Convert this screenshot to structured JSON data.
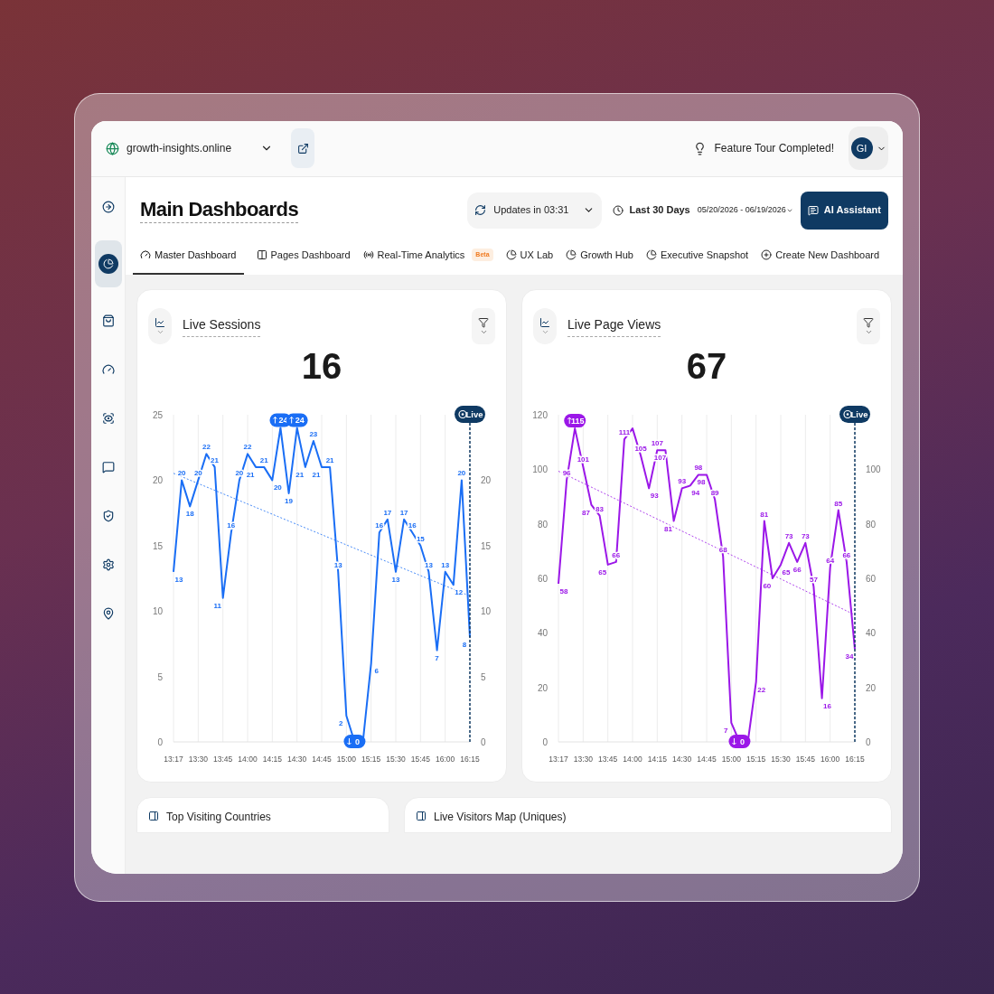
{
  "topbar": {
    "site": "growth-insights.online",
    "tour": "Feature Tour Completed!",
    "avatar": "GI"
  },
  "sidebar": {
    "items": [
      {
        "kind": "collapse",
        "selected": false
      },
      {
        "kind": "dashboard",
        "selected": true
      },
      {
        "kind": "bag",
        "selected": false
      },
      {
        "kind": "gauge",
        "selected": false
      },
      {
        "kind": "scan",
        "selected": false
      },
      {
        "kind": "chat",
        "selected": false
      },
      {
        "kind": "shield",
        "selected": false
      },
      {
        "kind": "settings",
        "selected": false
      },
      {
        "kind": "pin",
        "selected": false
      }
    ]
  },
  "header": {
    "title": "Main Dashboards",
    "updates": "Updates in 03:31",
    "range": "Last 30 Days",
    "dates": "05/20/2026 - 06/19/2026",
    "assistant": "AI Assistant"
  },
  "tabs": [
    {
      "label": "Master Dashboard",
      "selected": true
    },
    {
      "label": "Pages Dashboard",
      "selected": false
    },
    {
      "label": "Real-Time Analytics",
      "selected": false,
      "badge": "Beta"
    },
    {
      "label": "UX Lab",
      "selected": false
    },
    {
      "label": "Growth Hub",
      "selected": false
    },
    {
      "label": "Executive Snapshot",
      "selected": false
    },
    {
      "label": "Create New Dashboard",
      "selected": false
    }
  ],
  "cards": [
    {
      "title": "Live Sessions",
      "value": "16",
      "live_label": "Live",
      "chart_data": {
        "type": "line",
        "categories": [
          "13:17",
          null,
          null,
          "13:30",
          null,
          null,
          "13:45",
          null,
          null,
          "14:00",
          null,
          null,
          "14:15",
          null,
          null,
          "14:30",
          null,
          null,
          "14:45",
          null,
          null,
          "15:00",
          null,
          null,
          "15:15",
          null,
          null,
          "15:30",
          null,
          null,
          "15:45",
          null,
          null,
          "16:00",
          null,
          null,
          "16:15"
        ],
        "series": [
          {
            "color": "#1a6ef5",
            "values": [
              13,
              20,
              18,
              20,
              22,
              21,
              11,
              16,
              20,
              22,
              21,
              21,
              20,
              24,
              19,
              24,
              21,
              23,
              21,
              21,
              13,
              2,
              0,
              0,
              6,
              16,
              17,
              13,
              17,
              16,
              15,
              13,
              7,
              13,
              12,
              20,
              8
            ]
          }
        ],
        "ylim": [
          0,
          25
        ],
        "yticks": [
          0,
          5,
          10,
          15,
          20,
          25
        ],
        "y2lim": [
          0,
          25
        ],
        "y2ticks": [
          0,
          5,
          10,
          15,
          20
        ],
        "grid": true,
        "value_labels": [
          "13",
          "20",
          "18",
          "20",
          "22",
          "21",
          "11",
          "16",
          "20",
          "22",
          "21",
          "21",
          "20",
          "24",
          "19",
          "24",
          "21",
          "23",
          "21",
          "21",
          "13",
          "2",
          "0",
          null,
          "6",
          "16",
          "17",
          "13",
          "17",
          "16",
          "15",
          "13",
          "7",
          "13",
          "12",
          "20",
          "8"
        ]
      }
    },
    {
      "title": "Live Page Views",
      "value": "67",
      "live_label": "Live",
      "chart_data": {
        "type": "line",
        "categories": [
          "13:17",
          null,
          null,
          "13:30",
          null,
          null,
          "13:45",
          null,
          null,
          "14:00",
          null,
          null,
          "14:15",
          null,
          null,
          "14:30",
          null,
          null,
          "14:45",
          null,
          null,
          "15:00",
          null,
          null,
          "15:15",
          null,
          null,
          "15:30",
          null,
          null,
          "15:45",
          null,
          null,
          "16:00",
          null,
          null,
          "16:15"
        ],
        "series": [
          {
            "color": "#9b17e8",
            "values": [
              58,
              96,
              115,
              101,
              87,
              83,
              65,
              66,
              111,
              115,
              105,
              93,
              107,
              107,
              81,
              93,
              94,
              98,
              98,
              89,
              68,
              7,
              0,
              0,
              22,
              81,
              60,
              65,
              73,
              66,
              73,
              57,
              16,
              64,
              85,
              66,
              34
            ]
          }
        ],
        "ylim": [
          0,
          120
        ],
        "yticks": [
          0,
          20,
          40,
          60,
          80,
          100,
          120
        ],
        "y2lim": [
          0,
          120
        ],
        "y2ticks": [
          0,
          20,
          40,
          60,
          80,
          100
        ],
        "grid": true,
        "value_labels": [
          "58",
          "96",
          "115",
          "101",
          "87",
          "83",
          "65",
          "66",
          "111",
          null,
          "105",
          "93",
          "107",
          "107",
          "81",
          "93",
          "94",
          "98",
          "98",
          "89",
          "68",
          "7",
          "0",
          null,
          "22",
          "81",
          "60",
          "65",
          "73",
          "66",
          "73",
          "57",
          "16",
          "64",
          "85",
          "66",
          "34"
        ]
      }
    }
  ],
  "lower_cards": [
    {
      "title": "Top Visiting Countries"
    },
    {
      "title": "Live Visitors Map (Uniques)"
    }
  ]
}
